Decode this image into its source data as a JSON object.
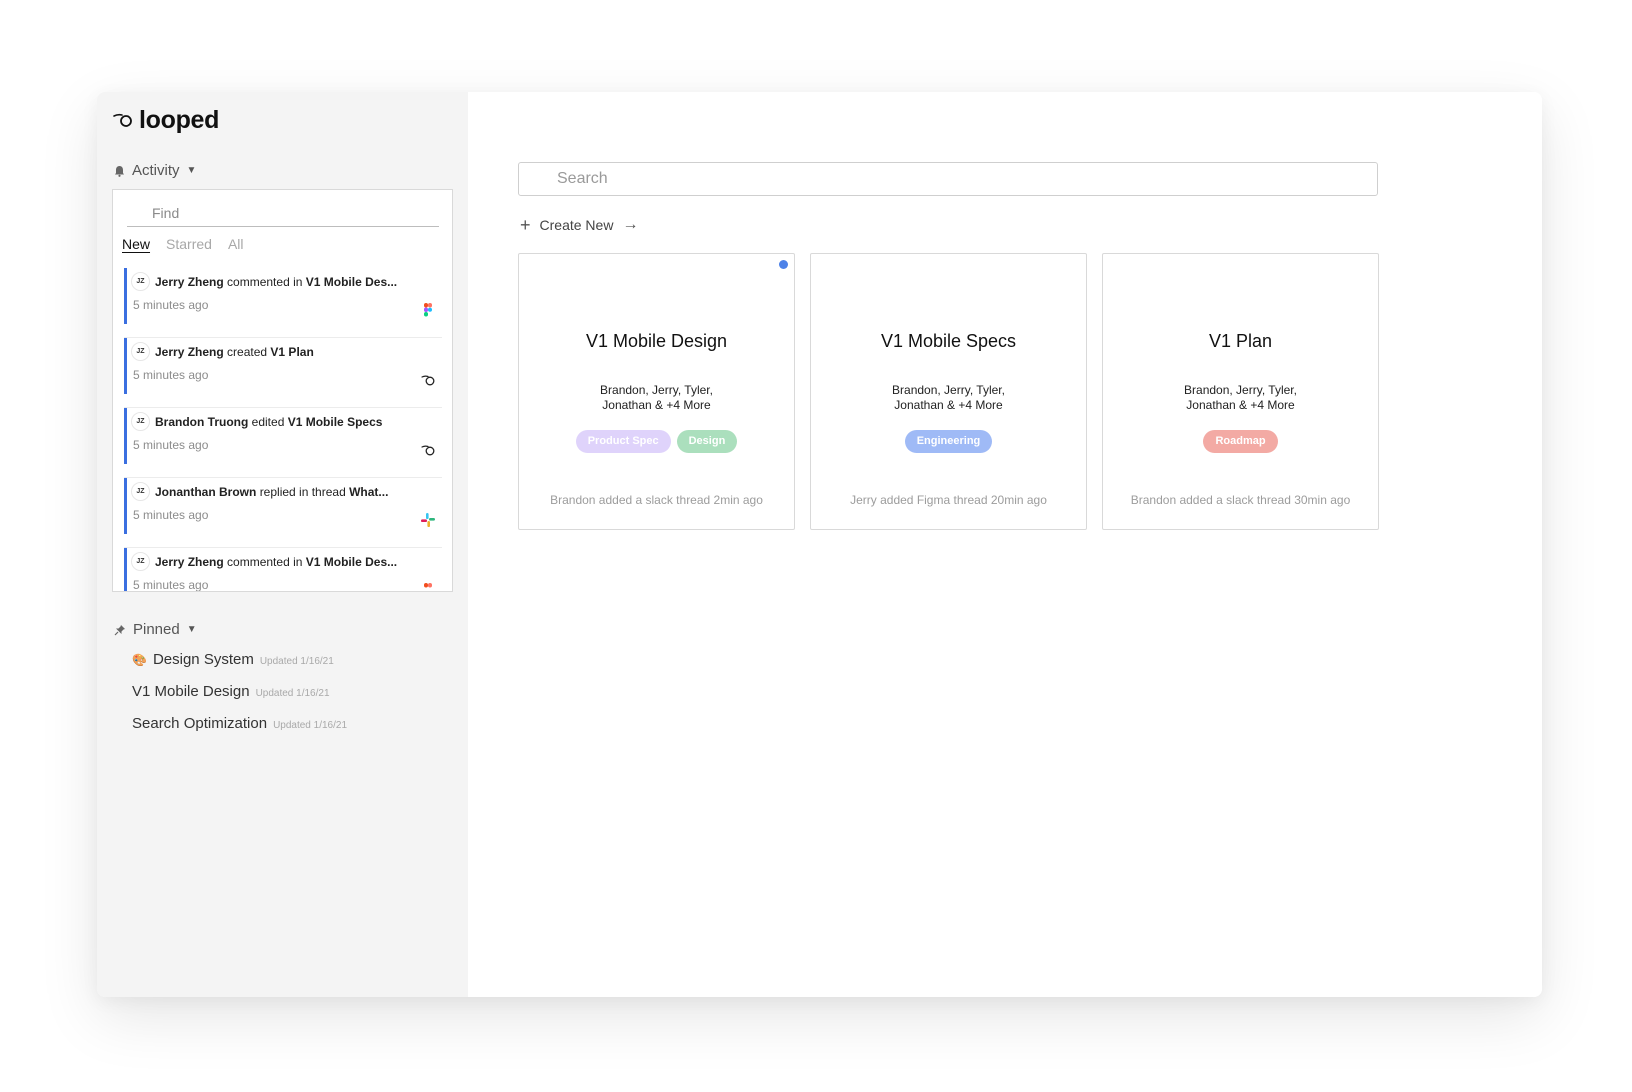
{
  "app": {
    "logo_text": "looped"
  },
  "sidebar": {
    "activity": {
      "label": "Activity",
      "find_placeholder": "Find",
      "tabs": [
        {
          "label": "New",
          "active": true
        },
        {
          "label": "Starred",
          "active": false
        },
        {
          "label": "All",
          "active": false
        }
      ],
      "items": [
        {
          "initials": "JZ",
          "actor": "Jerry Zheng",
          "action": "commented in",
          "target": "V1 Mobile Des...",
          "time": "5 minutes ago",
          "source_icon": "figma-icon"
        },
        {
          "initials": "JZ",
          "actor": "Jerry Zheng",
          "action": "created",
          "target": "V1 Plan",
          "time": "5 minutes ago",
          "source_icon": "looped-icon"
        },
        {
          "initials": "JZ",
          "actor": "Brandon Truong",
          "action": "edited",
          "target": "V1 Mobile Specs",
          "time": "5 minutes ago",
          "source_icon": "looped-icon"
        },
        {
          "initials": "JZ",
          "actor": "Jonanthan Brown",
          "action": "replied in thread",
          "target": "What...",
          "time": "5 minutes ago",
          "source_icon": "slack-icon"
        },
        {
          "initials": "JZ",
          "actor": "Jerry Zheng",
          "action": "commented in",
          "target": "V1 Mobile Des...",
          "time": "5 minutes ago",
          "source_icon": "figma-icon"
        }
      ]
    },
    "pinned": {
      "label": "Pinned",
      "items": [
        {
          "emoji": "🎨",
          "name": "Design System",
          "updated": "Updated 1/16/21"
        },
        {
          "emoji": "",
          "name": "V1 Mobile Design",
          "updated": "Updated 1/16/21"
        },
        {
          "emoji": "",
          "name": "Search Optimization",
          "updated": "Updated 1/16/21"
        }
      ]
    }
  },
  "main": {
    "search_placeholder": "Search",
    "create_new_label": "Create New",
    "cards": [
      {
        "title": "V1 Mobile Design",
        "members_line1": "Brandon, Jerry, Tyler,",
        "members_line2": "Jonathan & +4 More",
        "tags": [
          {
            "label": "Product Spec",
            "color": "#dfd3fb"
          },
          {
            "label": "Design",
            "color": "#abdfbd"
          }
        ],
        "footer": "Brandon added a slack thread 2min ago",
        "unread": true
      },
      {
        "title": "V1 Mobile Specs",
        "members_line1": "Brandon, Jerry, Tyler,",
        "members_line2": "Jonathan & +4 More",
        "tags": [
          {
            "label": "Engineering",
            "color": "#9fbaf6"
          }
        ],
        "footer": "Jerry added Figma thread 20min ago",
        "unread": false
      },
      {
        "title": "V1 Plan",
        "members_line1": "Brandon, Jerry, Tyler,",
        "members_line2": "Jonathan & +4 More",
        "tags": [
          {
            "label": "Roadmap",
            "color": "#f3aaa4"
          }
        ],
        "footer": "Brandon added a slack thread 30min ago",
        "unread": false
      }
    ]
  },
  "colors": {
    "accent": "#3b6fe0",
    "unread_dot": "#4d82e8",
    "sidebar_bg": "#f4f4f4"
  }
}
